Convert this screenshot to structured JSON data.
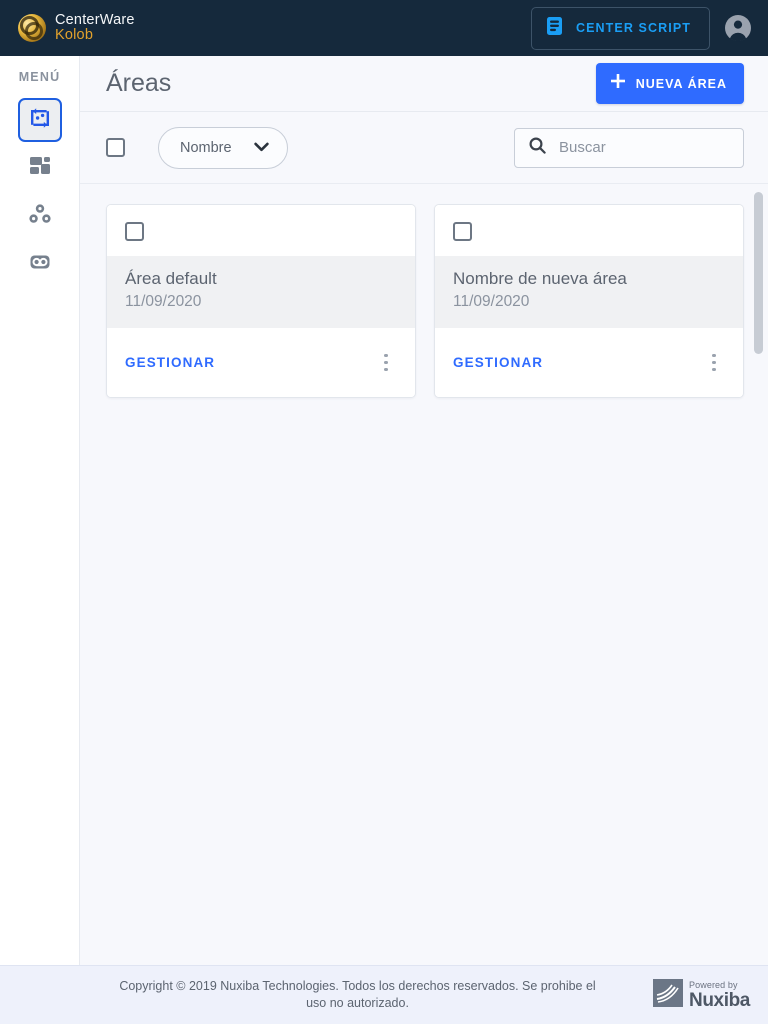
{
  "topbar": {
    "brand_line1": "CenterWare",
    "brand_line2": "Kolob",
    "brand_logo_icon": "centerware-circle-logo",
    "script_button": {
      "label": "CENTER SCRIPT",
      "icon": "document-list-icon",
      "color": "#1a9ef5"
    },
    "account_icon": "user-avatar-icon",
    "background": "#15293c"
  },
  "sidebar": {
    "title": "MENÚ",
    "items": [
      {
        "name": "transfer",
        "icon": "transfer-sync-icon",
        "active": true
      },
      {
        "name": "dashboard",
        "icon": "dashboard-grid-icon",
        "active": false
      },
      {
        "name": "groups",
        "icon": "three-circles-icon",
        "active": false
      },
      {
        "name": "voicemail",
        "icon": "voicemail-icon",
        "active": false
      }
    ],
    "active_color": "#1f5fe0"
  },
  "page": {
    "title": "Áreas",
    "new_button": {
      "label": "NUEVA ÁREA",
      "icon": "plus-icon",
      "color": "#2f6bff"
    }
  },
  "toolbar": {
    "select_all_checkbox": {
      "checked": false
    },
    "sort_select": {
      "value": "Nombre",
      "icon": "chevron-down-icon"
    },
    "search": {
      "value": "",
      "placeholder": "Buscar",
      "icon": "search-icon"
    }
  },
  "cards": [
    {
      "checkbox": {
        "checked": false
      },
      "name": "Área default",
      "date": "11/09/2020",
      "manage_label": "GESTIONAR",
      "menu_icon": "kebab-menu-icon"
    },
    {
      "checkbox": {
        "checked": false
      },
      "name": "Nombre de nueva área",
      "date": "11/09/2020",
      "manage_label": "GESTIONAR",
      "menu_icon": "kebab-menu-icon"
    }
  ],
  "scrollbar": {
    "visible": true
  },
  "footer": {
    "copyright": "Copyright © 2019 Nuxiba Technologies. Todos los derechos reservados. Se prohibe el uso no autorizado.",
    "powered_by": "Powered by",
    "vendor": "Nuxiba",
    "vendor_icon": "nuxiba-swoosh-logo"
  }
}
